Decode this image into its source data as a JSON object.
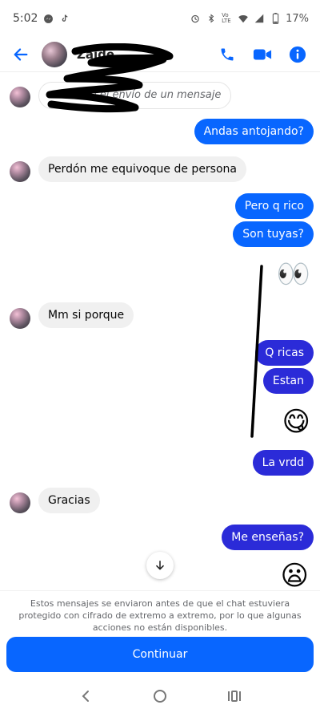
{
  "status_bar": {
    "time": "5:02",
    "battery": "17%",
    "network": "Vo LTE"
  },
  "header": {
    "contact_name": "Zaide",
    "icons": [
      "back-arrow-icon",
      "phone-icon",
      "video-icon",
      "info-icon"
    ],
    "accent": "#0866ff"
  },
  "messages": [
    {
      "side": "in",
      "type": "unsent",
      "text": "ló el envío de un mensaje"
    },
    {
      "side": "out",
      "text": "Andas antojando?"
    },
    {
      "side": "in",
      "text": "Perdón me equivoque de persona"
    },
    {
      "side": "out",
      "text": "Pero q rico"
    },
    {
      "side": "out",
      "text": "Son tuyas?"
    },
    {
      "side": "out",
      "type": "emoji",
      "text": "👀"
    },
    {
      "side": "in",
      "text": "Mm si porque"
    },
    {
      "side": "out",
      "text": "Q ricas"
    },
    {
      "side": "out",
      "text": "Estan"
    },
    {
      "side": "out",
      "type": "emoji",
      "text": "😋"
    },
    {
      "side": "out",
      "text": "La vrdd"
    },
    {
      "side": "in",
      "text": "Gracias"
    },
    {
      "side": "out",
      "text": "Me enseñas?"
    },
    {
      "side": "out",
      "type": "emoji",
      "text": "😦"
    }
  ],
  "footer": {
    "notice": "Estos mensajes se enviaron antes de que el chat estuviera protegido con cifrado de extremo a extremo, por lo que algunas acciones no están disponibles.",
    "continue_label": "Continuar"
  },
  "colors": {
    "outgoing": "#0866ff",
    "outgoing_dark": "#2b2bd8",
    "incoming": "#f0f0f0"
  }
}
